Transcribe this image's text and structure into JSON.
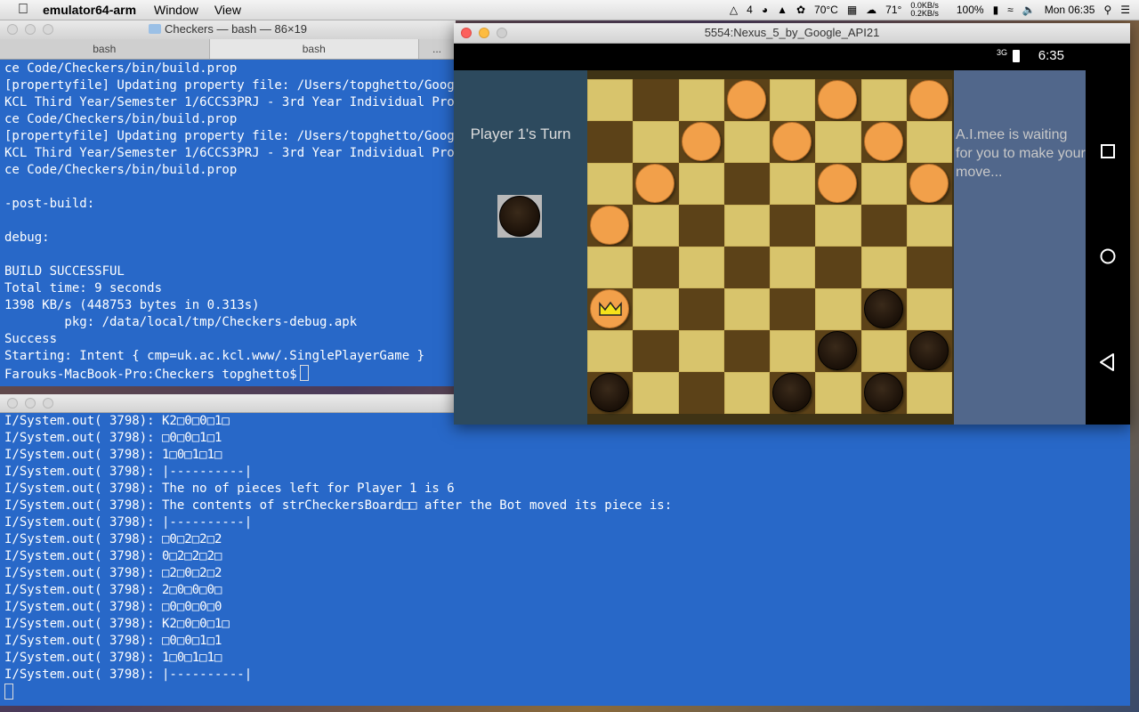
{
  "menubar": {
    "app_name": "emulator64-arm",
    "menus": [
      "Window",
      "View"
    ],
    "status": {
      "num_badge": "4",
      "cpu_temp": "70°C",
      "weather_temp": "71°",
      "net_up": "0.0KB/s",
      "net_down": "0.2KB/s",
      "battery": "100%",
      "clock": "Mon 06:35"
    }
  },
  "term1": {
    "title": "Checkers — bash — 86×19",
    "tabs": [
      "bash",
      "bash",
      "..."
    ],
    "lines": [
      "ce Code/Checkers/bin/build.prop",
      "[propertyfile] Updating property file: /Users/topghetto/Google",
      "KCL Third Year/Semester 1/6CCS3PRJ - 3rd Year Individual Projec",
      "ce Code/Checkers/bin/build.prop",
      "[propertyfile] Updating property file: /Users/topghetto/Google",
      "KCL Third Year/Semester 1/6CCS3PRJ - 3rd Year Individual Projec",
      "ce Code/Checkers/bin/build.prop",
      "",
      "-post-build:",
      "",
      "debug:",
      "",
      "BUILD SUCCESSFUL",
      "Total time: 9 seconds",
      "1398 KB/s (448753 bytes in 0.313s)",
      "        pkg: /data/local/tmp/Checkers-debug.apk",
      "Success",
      "Starting: Intent { cmp=uk.ac.kcl.www/.SinglePlayerGame }",
      "Farouks-MacBook-Pro:Checkers topghetto$"
    ]
  },
  "term2": {
    "lines": [
      "I/System.out( 3798): K2□0□0□1□",
      "I/System.out( 3798): □0□0□1□1",
      "I/System.out( 3798): 1□0□1□1□",
      "I/System.out( 3798): |----------|",
      "I/System.out( 3798): The no of pieces left for Player 1 is 6",
      "I/System.out( 3798): The contents of strCheckersBoard□□ after the Bot moved its piece is:",
      "I/System.out( 3798): |----------|",
      "I/System.out( 3798): □0□2□2□2",
      "I/System.out( 3798): 0□2□2□2□",
      "I/System.out( 3798): □2□0□2□2",
      "I/System.out( 3798): 2□0□0□0□",
      "I/System.out( 3798): □0□0□0□0",
      "I/System.out( 3798): K2□0□0□1□",
      "I/System.out( 3798): □0□0□1□1",
      "I/System.out( 3798): 1□0□1□1□",
      "I/System.out( 3798): |----------|"
    ]
  },
  "emulator": {
    "title": "5554:Nexus_5_by_Google_API21",
    "status_time": "6:35",
    "network": "3G",
    "turn_label": "Player 1's Turn",
    "ai_message": "A.I.mee is waiting for you to make your move...",
    "board": [
      [
        "",
        "",
        "",
        "O",
        "",
        "O",
        "",
        "O"
      ],
      [
        "",
        "",
        "O",
        "",
        "O",
        "",
        "O",
        ""
      ],
      [
        "",
        "O",
        "",
        "",
        "",
        "O",
        "",
        "O"
      ],
      [
        "O",
        "",
        "",
        "",
        "",
        "",
        "",
        ""
      ],
      [
        "",
        "",
        "",
        "",
        "",
        "",
        "",
        ""
      ],
      [
        "OK",
        "",
        "",
        "",
        "",
        "",
        "B",
        ""
      ],
      [
        "",
        "",
        "",
        "",
        "",
        "B",
        "",
        "B"
      ],
      [
        "B",
        "",
        "",
        "",
        "B",
        "",
        "B",
        ""
      ]
    ]
  },
  "colors": {
    "terminal_bg": "#2868c8",
    "orange_piece": "#f2a04a",
    "dark_piece": "#1a1008",
    "light_square": "#d8c46c",
    "dark_square": "#5c4218"
  }
}
